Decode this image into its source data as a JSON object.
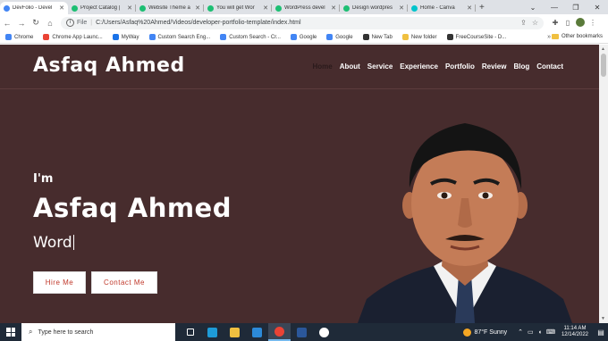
{
  "browser": {
    "tabs": [
      {
        "title": "DevFolio - Devel",
        "active": true,
        "color": "#4285f4"
      },
      {
        "title": "Project Catalog |",
        "active": false,
        "color": "#1dbf73"
      },
      {
        "title": "Website Theme a",
        "active": false,
        "color": "#1dbf73"
      },
      {
        "title": "You will get Wor",
        "active": false,
        "color": "#1dbf73"
      },
      {
        "title": "WordPress devel",
        "active": false,
        "color": "#1dbf73"
      },
      {
        "title": "Design wordpres",
        "active": false,
        "color": "#1dbf73"
      },
      {
        "title": "Home - Canva",
        "active": false,
        "color": "#00c4cc"
      }
    ],
    "new_tab_label": "+",
    "address": {
      "scheme_label": "File",
      "url": "C:/Users/Asfaq%20Ahmed/Videos/developer-portfolio-template/index.html"
    },
    "bookmarks": [
      {
        "label": "Chrome",
        "color": "#4285f4"
      },
      {
        "label": "Chrome App Launc...",
        "color": "#ea4335"
      },
      {
        "label": "MyWay",
        "color": "#1a73e8"
      },
      {
        "label": "Custom Search Eng...",
        "color": "#4285f4"
      },
      {
        "label": "Custom Search - Cr...",
        "color": "#4285f4"
      },
      {
        "label": "Google",
        "color": "#4285f4"
      },
      {
        "label": "Google",
        "color": "#4285f4"
      },
      {
        "label": "New Tab",
        "color": "#333333"
      },
      {
        "label": "New folder",
        "color": "#f0c040"
      },
      {
        "label": "FreeCourseSite - D...",
        "color": "#333333"
      }
    ],
    "more_bookmarks": "»",
    "other_bookmarks": "Other bookmarks"
  },
  "site": {
    "brand": "Asfaq Ahmed",
    "nav": [
      {
        "label": "Home",
        "current": true
      },
      {
        "label": "About",
        "current": false
      },
      {
        "label": "Service",
        "current": false
      },
      {
        "label": "Experience",
        "current": false
      },
      {
        "label": "Portfolio",
        "current": false
      },
      {
        "label": "Review",
        "current": false
      },
      {
        "label": "Blog",
        "current": false
      },
      {
        "label": "Contact",
        "current": false
      }
    ],
    "hero": {
      "greeting": "I'm",
      "name": "Asfaq Ahmed",
      "typed_role": "Word",
      "hire_button": "Hire Me",
      "contact_button": "Contact Me"
    },
    "colors": {
      "background": "#472c2d",
      "button_text": "#c0392b"
    }
  },
  "taskbar": {
    "search_placeholder": "Type here to search",
    "apps": [
      {
        "name": "task-view",
        "color": "#ffffff"
      },
      {
        "name": "edge",
        "color": "#1e9bd7"
      },
      {
        "name": "file-explorer",
        "color": "#f0c040"
      },
      {
        "name": "vscode",
        "color": "#2c8ad8"
      },
      {
        "name": "chrome",
        "color": "#ea4335"
      },
      {
        "name": "word",
        "color": "#2b579a"
      },
      {
        "name": "settings",
        "color": "#ffffff"
      }
    ],
    "weather": "87°F  Sunny",
    "time": "11:14 AM",
    "date": "12/14/2022"
  }
}
